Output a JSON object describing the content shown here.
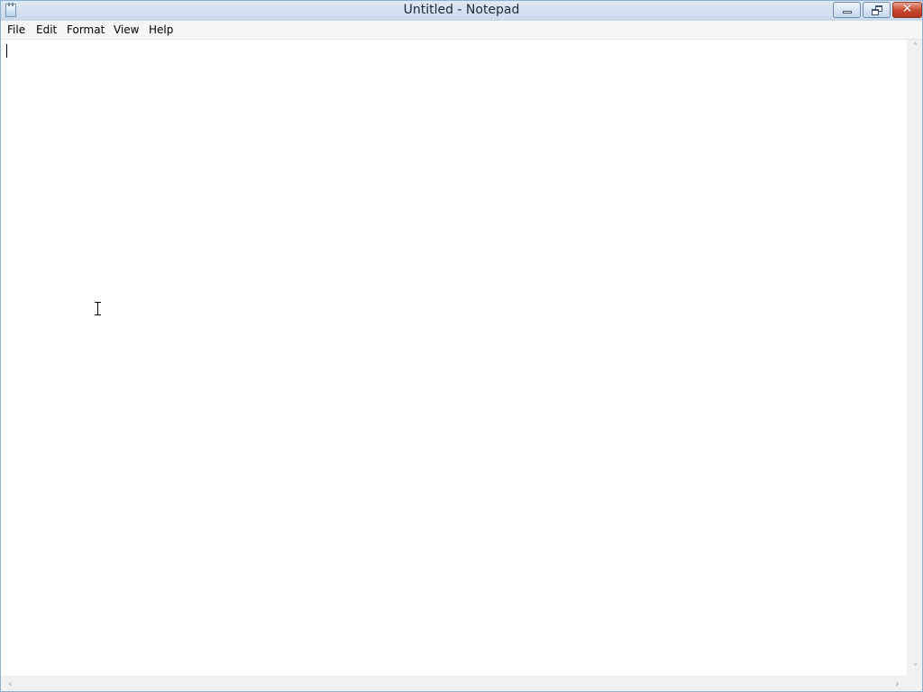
{
  "window": {
    "title": "Untitled - Notepad"
  },
  "titlebar_buttons": {
    "close_glyph": "✕"
  },
  "menu": {
    "items": [
      "File",
      "Edit",
      "Format",
      "View",
      "Help"
    ]
  },
  "editor": {
    "content": ""
  },
  "scrollbars": {
    "up_arrow": "˄",
    "down_arrow": "˅",
    "left_arrow": "‹",
    "right_arrow": "›"
  },
  "icons": {
    "app": "notepad-icon",
    "minimize": "minimize-icon",
    "restore": "restore-icon",
    "close": "close-icon"
  },
  "colors": {
    "titlebar": "#cad9ea",
    "close_button": "#c8452c",
    "menubar": "#f5f6f7",
    "editor_bg": "#ffffff"
  }
}
